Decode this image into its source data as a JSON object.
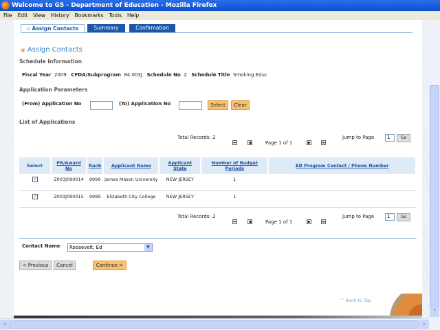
{
  "window": {
    "title": "Welcome to G5 - Department of Education - Mozilla Firefox"
  },
  "menu": [
    "File",
    "Edit",
    "View",
    "History",
    "Bookmarks",
    "Tools",
    "Help"
  ],
  "tabs": [
    {
      "label": "Assign Contacts",
      "active": true
    },
    {
      "label": "Summary"
    },
    {
      "label": "Confirmation"
    }
  ],
  "heading": "Assign Contacts",
  "schedule": {
    "section": "Schedule Information",
    "fiscal_year_label": "Fiscal Year",
    "fiscal_year": "2009",
    "cfda_label": "CFDA/Subprogram",
    "cfda": "84.003J",
    "schedule_no_label": "Schedule No",
    "schedule_no": "2",
    "schedule_title_label": "Schedule Title",
    "schedule_title": "Smoking Educ"
  },
  "params": {
    "section": "Application Parameters",
    "from_label": "(From) Application No",
    "from_value": "",
    "to_label": "(To) Application No",
    "to_value": "",
    "select": "Select",
    "clear": "Clear"
  },
  "list": {
    "section": "List of Applications",
    "total": "Total Records: 2",
    "page": "Page 1 of 1",
    "jump_label": "Jump to Page",
    "jump_value": "1",
    "go": "Go",
    "columns": [
      "Select",
      "PR/Award No",
      "Rank",
      "Applicant Name",
      "Applicant State",
      "Number of Budget Periods",
      "ED Program Contact / Phone Number"
    ],
    "rows": [
      {
        "checked": true,
        "award": "Z003J090014",
        "rank": "9999",
        "name": "James Mason University",
        "state": "NEW JERSEY",
        "periods": "1",
        "contact": ""
      },
      {
        "checked": true,
        "award": "Z003J090015",
        "rank": "9999",
        "name": "Elizabeth City College",
        "state": "NEW JERSEY",
        "periods": "1",
        "contact": ""
      }
    ]
  },
  "contact": {
    "label": "Contact Name",
    "value": "Roosevelt, Ed"
  },
  "buttons": {
    "previous": "< Previous",
    "cancel": "Cancel",
    "continue": "Continue >"
  },
  "back_to_top": "^ Back to Top"
}
